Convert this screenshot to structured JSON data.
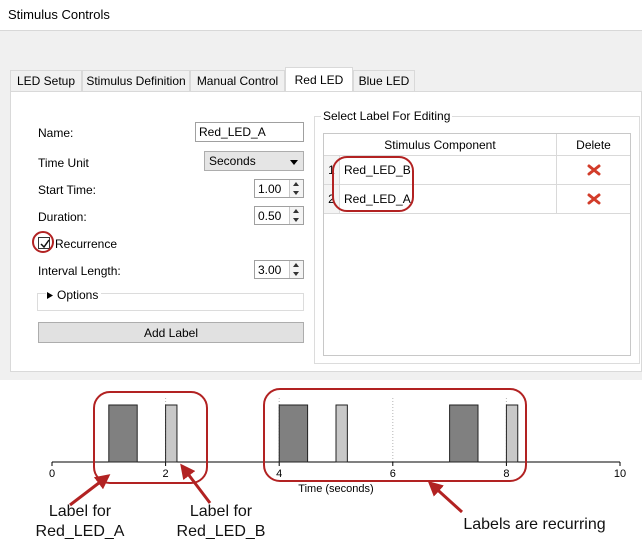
{
  "window": {
    "title": "Stimulus Controls"
  },
  "tabs": [
    {
      "label": "LED Setup",
      "active": false
    },
    {
      "label": "Stimulus Definition",
      "active": false
    },
    {
      "label": "Manual Control",
      "active": false
    },
    {
      "label": "Red LED",
      "active": true
    },
    {
      "label": "Blue LED",
      "active": false
    }
  ],
  "form": {
    "name_label": "Name:",
    "name_value": "Red_LED_A",
    "time_unit_label": "Time Unit",
    "time_unit_value": "Seconds",
    "start_time_label": "Start Time:",
    "start_time_value": "1.00",
    "duration_label": "Duration:",
    "duration_value": "0.50",
    "recurrence_label": "Recurrence",
    "recurrence_checked": true,
    "interval_label": "Interval Length:",
    "interval_value": "3.00",
    "options_label": "Options",
    "add_label_button": "Add Label"
  },
  "label_group": {
    "title": "Select Label For Editing",
    "col_component": "Stimulus Component",
    "col_delete": "Delete",
    "rows": [
      {
        "index": "1",
        "name": "Red_LED_B"
      },
      {
        "index": "2",
        "name": "Red_LED_A"
      }
    ]
  },
  "chart_data": {
    "type": "bar",
    "xlabel": "Time (seconds)",
    "xlim": [
      0,
      10
    ],
    "tick_labels": [
      "0",
      "2",
      "4",
      "6",
      "8",
      "10"
    ],
    "grid": "dotted vertical at 2, 4, 6, 8",
    "series": [
      {
        "name": "Red_LED_A",
        "color": "#808080",
        "pulses": [
          [
            1.0,
            1.5
          ],
          [
            4.0,
            4.5
          ],
          [
            7.0,
            7.5
          ]
        ]
      },
      {
        "name": "Red_LED_B",
        "color": "#c8c8c8",
        "pulses": [
          [
            2.0,
            2.2
          ],
          [
            5.0,
            5.2
          ],
          [
            8.0,
            8.2
          ]
        ]
      }
    ]
  },
  "annotations": {
    "label_a": [
      "Label for",
      "Red_LED_A"
    ],
    "label_b": [
      "Label for",
      "Red_LED_B"
    ],
    "recurring": "Labels are recurring",
    "highlight_color": "#b22222"
  }
}
